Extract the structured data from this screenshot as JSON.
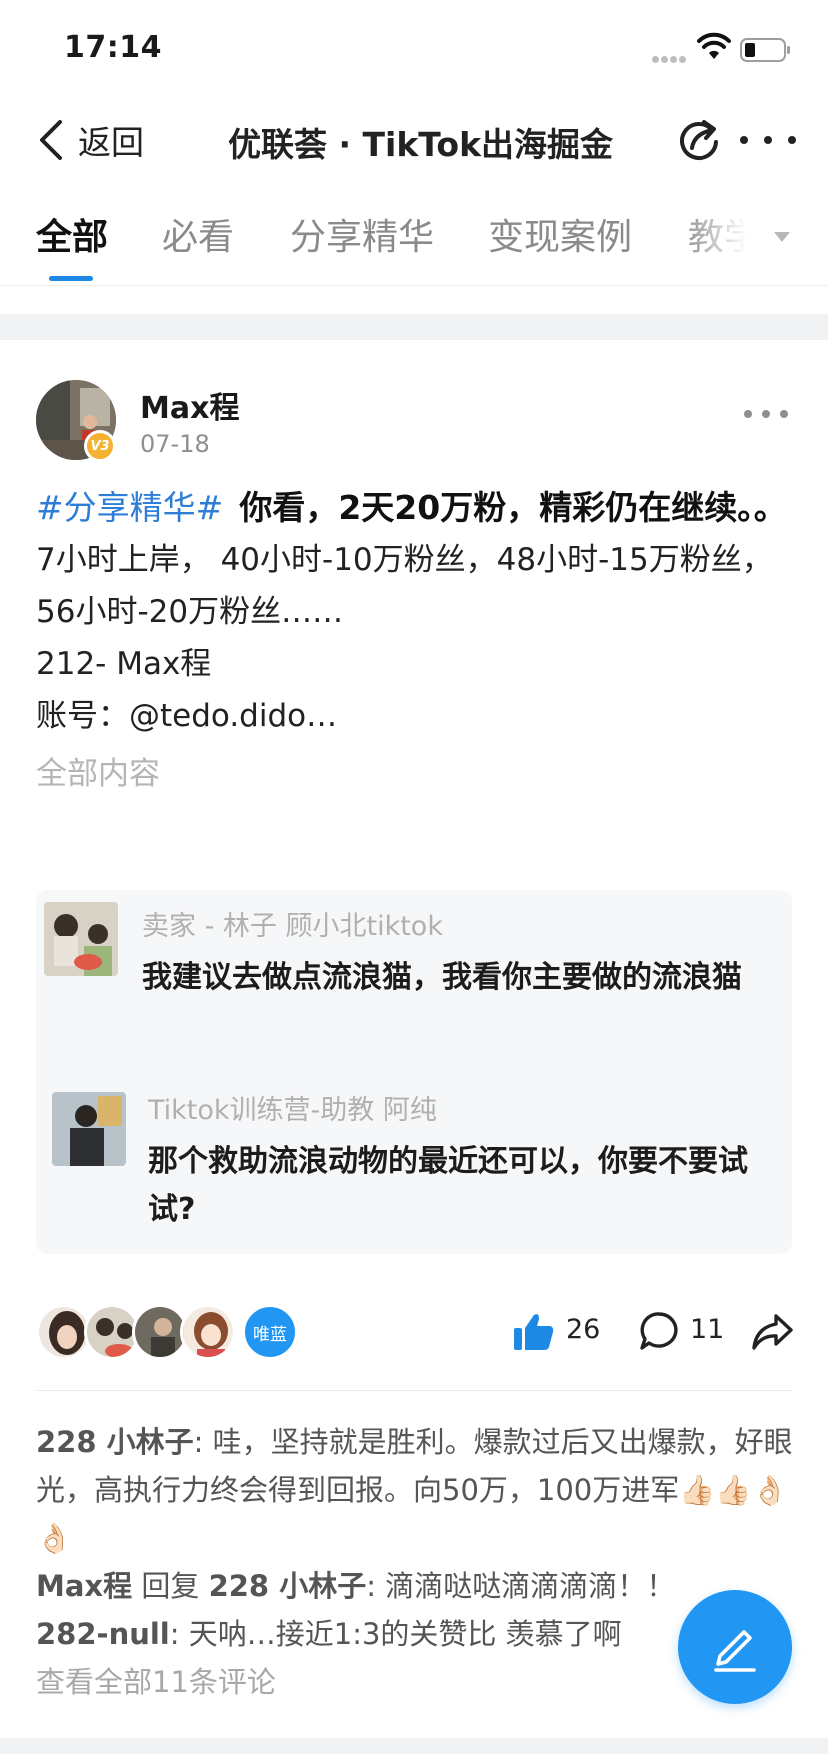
{
  "status_bar": {
    "time": "17:14"
  },
  "nav": {
    "back_label": "返回",
    "title": "优联荟 · TikTok出海掘金"
  },
  "tabs": [
    {
      "label": "全部",
      "active": true
    },
    {
      "label": "必看",
      "active": false
    },
    {
      "label": "分享精华",
      "active": false
    },
    {
      "label": "变现案例",
      "active": false
    },
    {
      "label": "教学",
      "active": false
    }
  ],
  "post": {
    "author": "Max程",
    "badge": "V3",
    "date": "07-18",
    "hashtag": "#分享精华#",
    "title": "你看，2天20万粉，精彩仍在继续。。",
    "text": "7小时上岸，  40小时-10万粉丝，48小时-15万粉丝，56小时-20万粉丝……\n212- Max程\n账号：@tedo.dido…",
    "expand_label": "全部内容"
  },
  "replies": [
    {
      "name": "卖家 - 林子 顾小北tiktok",
      "text": "我建议去做点流浪猫，我看你主要做的流浪猫"
    },
    {
      "name": "Tiktok训练营-助教 阿纯",
      "text": "那个救助流浪动物的最近还可以，你要不要试试?"
    }
  ],
  "engagement": {
    "liker_label": "唯蓝",
    "likes": "26",
    "comments": "11"
  },
  "comments": [
    {
      "user": "228 小林子",
      "sep": ": ",
      "text": "哇，坚持就是胜利。爆款过后又出爆款，好眼光，高执行力终会得到回报。向50万，100万进军👍🏻👍🏻👌🏻👌🏻"
    },
    {
      "user": "Max程",
      "reply_word": " 回复 ",
      "reply_to": "228 小林子",
      "sep": ": ",
      "text": "滴滴哒哒滴滴滴滴！！"
    },
    {
      "user": "282-null",
      "sep": ": ",
      "text": "天呐…接近1:3的关赞比 羡慕了啊"
    }
  ],
  "view_all_label": "查看全部11条评论",
  "colors": {
    "accent": "#2196f3",
    "link": "#2e7dd7"
  },
  "icons": [
    "back-chevron-icon",
    "share-out-icon",
    "more-icon",
    "thumbs-up-icon",
    "comment-bubble-icon",
    "forward-arrow-icon",
    "edit-pencil-icon",
    "wifi-icon",
    "battery-icon"
  ]
}
